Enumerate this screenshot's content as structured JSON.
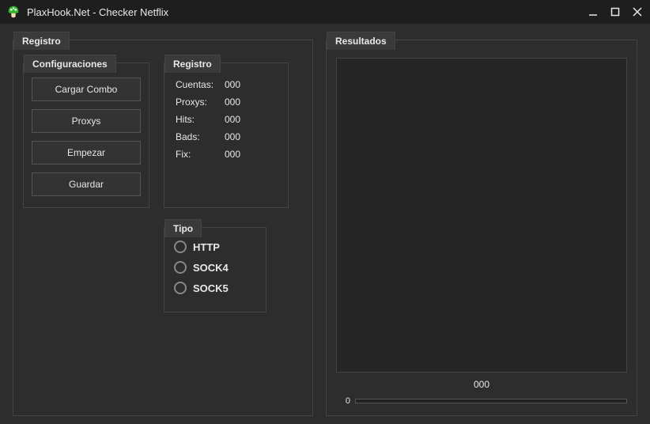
{
  "window": {
    "title": "PlaxHook.Net - Checker Netflix"
  },
  "panels": {
    "registro": "Registro",
    "configuraciones": "Configuraciones",
    "stats_title": "Registro",
    "tipo": "Tipo",
    "resultados": "Resultados"
  },
  "buttons": {
    "cargar_combo": "Cargar Combo",
    "proxys": "Proxys",
    "empezar": "Empezar",
    "guardar": "Guardar"
  },
  "stats": {
    "cuentas_label": "Cuentas:",
    "cuentas_value": "000",
    "proxys_label": "Proxys:",
    "proxys_value": "000",
    "hits_label": "Hits:",
    "hits_value": "000",
    "bads_label": "Bads:",
    "bads_value": "000",
    "fix_label": "Fix:",
    "fix_value": "000"
  },
  "proxy_types": {
    "http": "HTTP",
    "sock4": "SOCK4",
    "sock5": "SOCK5"
  },
  "results": {
    "counter": "000",
    "progress": "0"
  }
}
